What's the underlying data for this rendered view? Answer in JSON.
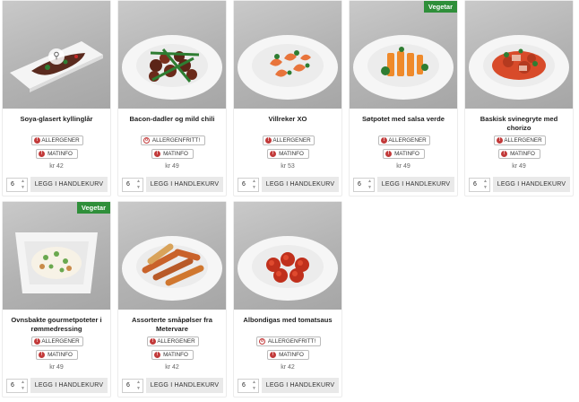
{
  "products": [
    {
      "title": "Soya-glasert kyllinglår",
      "allergy_label": "ALLERGENER",
      "allergy_free": false,
      "matinfo_label": "MATINFO",
      "price": "kr 42",
      "qty": "6",
      "cart_label": "LEGG I HANDLEKURV",
      "badge": "",
      "image": "glazed-chicken-plate"
    },
    {
      "title": "Bacon-dadler og mild chili",
      "allergy_label": "ALLERGENFRITT!",
      "allergy_free": true,
      "matinfo_label": "MATINFO",
      "price": "kr 49",
      "qty": "6",
      "cart_label": "LEGG I HANDLEKURV",
      "badge": "",
      "image": "bacon-dates-bowl"
    },
    {
      "title": "Villreker XO",
      "allergy_label": "ALLERGENER",
      "allergy_free": false,
      "matinfo_label": "MATINFO",
      "price": "kr 53",
      "qty": "6",
      "cart_label": "LEGG I HANDLEKURV",
      "badge": "",
      "image": "shrimp-bowl"
    },
    {
      "title": "Søtpotet med salsa verde",
      "allergy_label": "ALLERGENER",
      "allergy_free": false,
      "matinfo_label": "MATINFO",
      "price": "kr 49",
      "qty": "6",
      "cart_label": "LEGG I HANDLEKURV",
      "badge": "Vegetar",
      "image": "sweet-potato-bowl"
    },
    {
      "title": "Baskisk svinegryte med chorizo",
      "allergy_label": "ALLERGENER",
      "allergy_free": false,
      "matinfo_label": "MATINFO",
      "price": "kr 49",
      "qty": "6",
      "cart_label": "LEGG I HANDLEKURV",
      "badge": "",
      "image": "pork-stew-bowl"
    },
    {
      "title": "Ovnsbakte gourmetpoteter i rømmedressing",
      "allergy_label": "ALLERGENER",
      "allergy_free": false,
      "matinfo_label": "MATINFO",
      "price": "kr 49",
      "qty": "6",
      "cart_label": "LEGG I HANDLEKURV",
      "badge": "Vegetar",
      "image": "potato-dish"
    },
    {
      "title": "Assorterte småpølser fra Metervare",
      "allergy_label": "ALLERGENER",
      "allergy_free": false,
      "matinfo_label": "MATINFO",
      "price": "kr 42",
      "qty": "6",
      "cart_label": "LEGG I HANDLEKURV",
      "badge": "",
      "image": "sausages-bowl"
    },
    {
      "title": "Albondigas med tomatsaus",
      "allergy_label": "ALLERGENFRITT!",
      "allergy_free": true,
      "matinfo_label": "MATINFO",
      "price": "kr 42",
      "qty": "6",
      "cart_label": "LEGG I HANDLEKURV",
      "badge": "",
      "image": "meatballs-bowl"
    }
  ],
  "icons": {
    "zoom": "zoom-icon",
    "warning": "warning-icon",
    "info": "info-icon",
    "up": "chevron-up-icon",
    "down": "chevron-down-icon"
  },
  "colors": {
    "badge_green": "#2f8f3a",
    "warning_red": "#c23a3a",
    "cart_button": "#e9e9e9"
  }
}
